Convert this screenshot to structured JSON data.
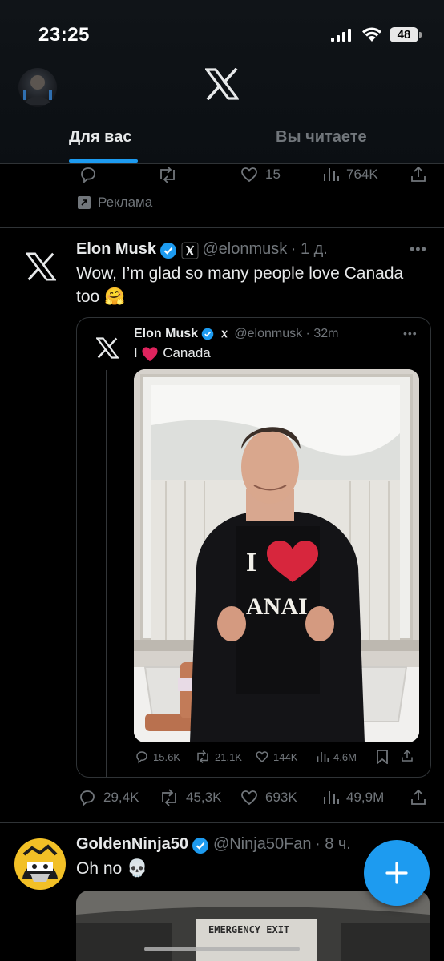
{
  "status": {
    "time": "23:25",
    "battery": "48"
  },
  "header": {
    "tabs": [
      {
        "label": "Для вас"
      },
      {
        "label": "Вы читаете"
      }
    ]
  },
  "prev_tweet": {
    "reply_count": "",
    "retweet_count": "",
    "like_count": "15",
    "view_count": "764K",
    "ad_label": "Реклама"
  },
  "tweet": {
    "name": "Elon Musk",
    "handle": "@elonmusk",
    "time": "· 1 д.",
    "text_line1": "Wow, I’m glad so many people love Canada",
    "text_line2": "too 🤗",
    "reply_count": "29,4K",
    "retweet_count": "45,3K",
    "like_count": "693K",
    "view_count": "49,9M",
    "quote": {
      "name": "Elon Musk",
      "handle": "@elonmusk",
      "time": "· 32m",
      "text_prefix": "I",
      "text_suffix": "Canada",
      "shirt_text": "ANAI",
      "reply_count": "15.6K",
      "retweet_count": "21.1K",
      "like_count": "144K",
      "view_count": "4.6M"
    }
  },
  "next_tweet": {
    "name": "GoldenNinja50",
    "handle": "@Ninja50Fan",
    "time": "· 8 ч.",
    "text": "Oh no 💀",
    "image_caption": "EMERGENCY EXIT"
  },
  "colors": {
    "accent": "#1d9bf0",
    "muted": "#71767b",
    "heart": "#e0245e"
  }
}
